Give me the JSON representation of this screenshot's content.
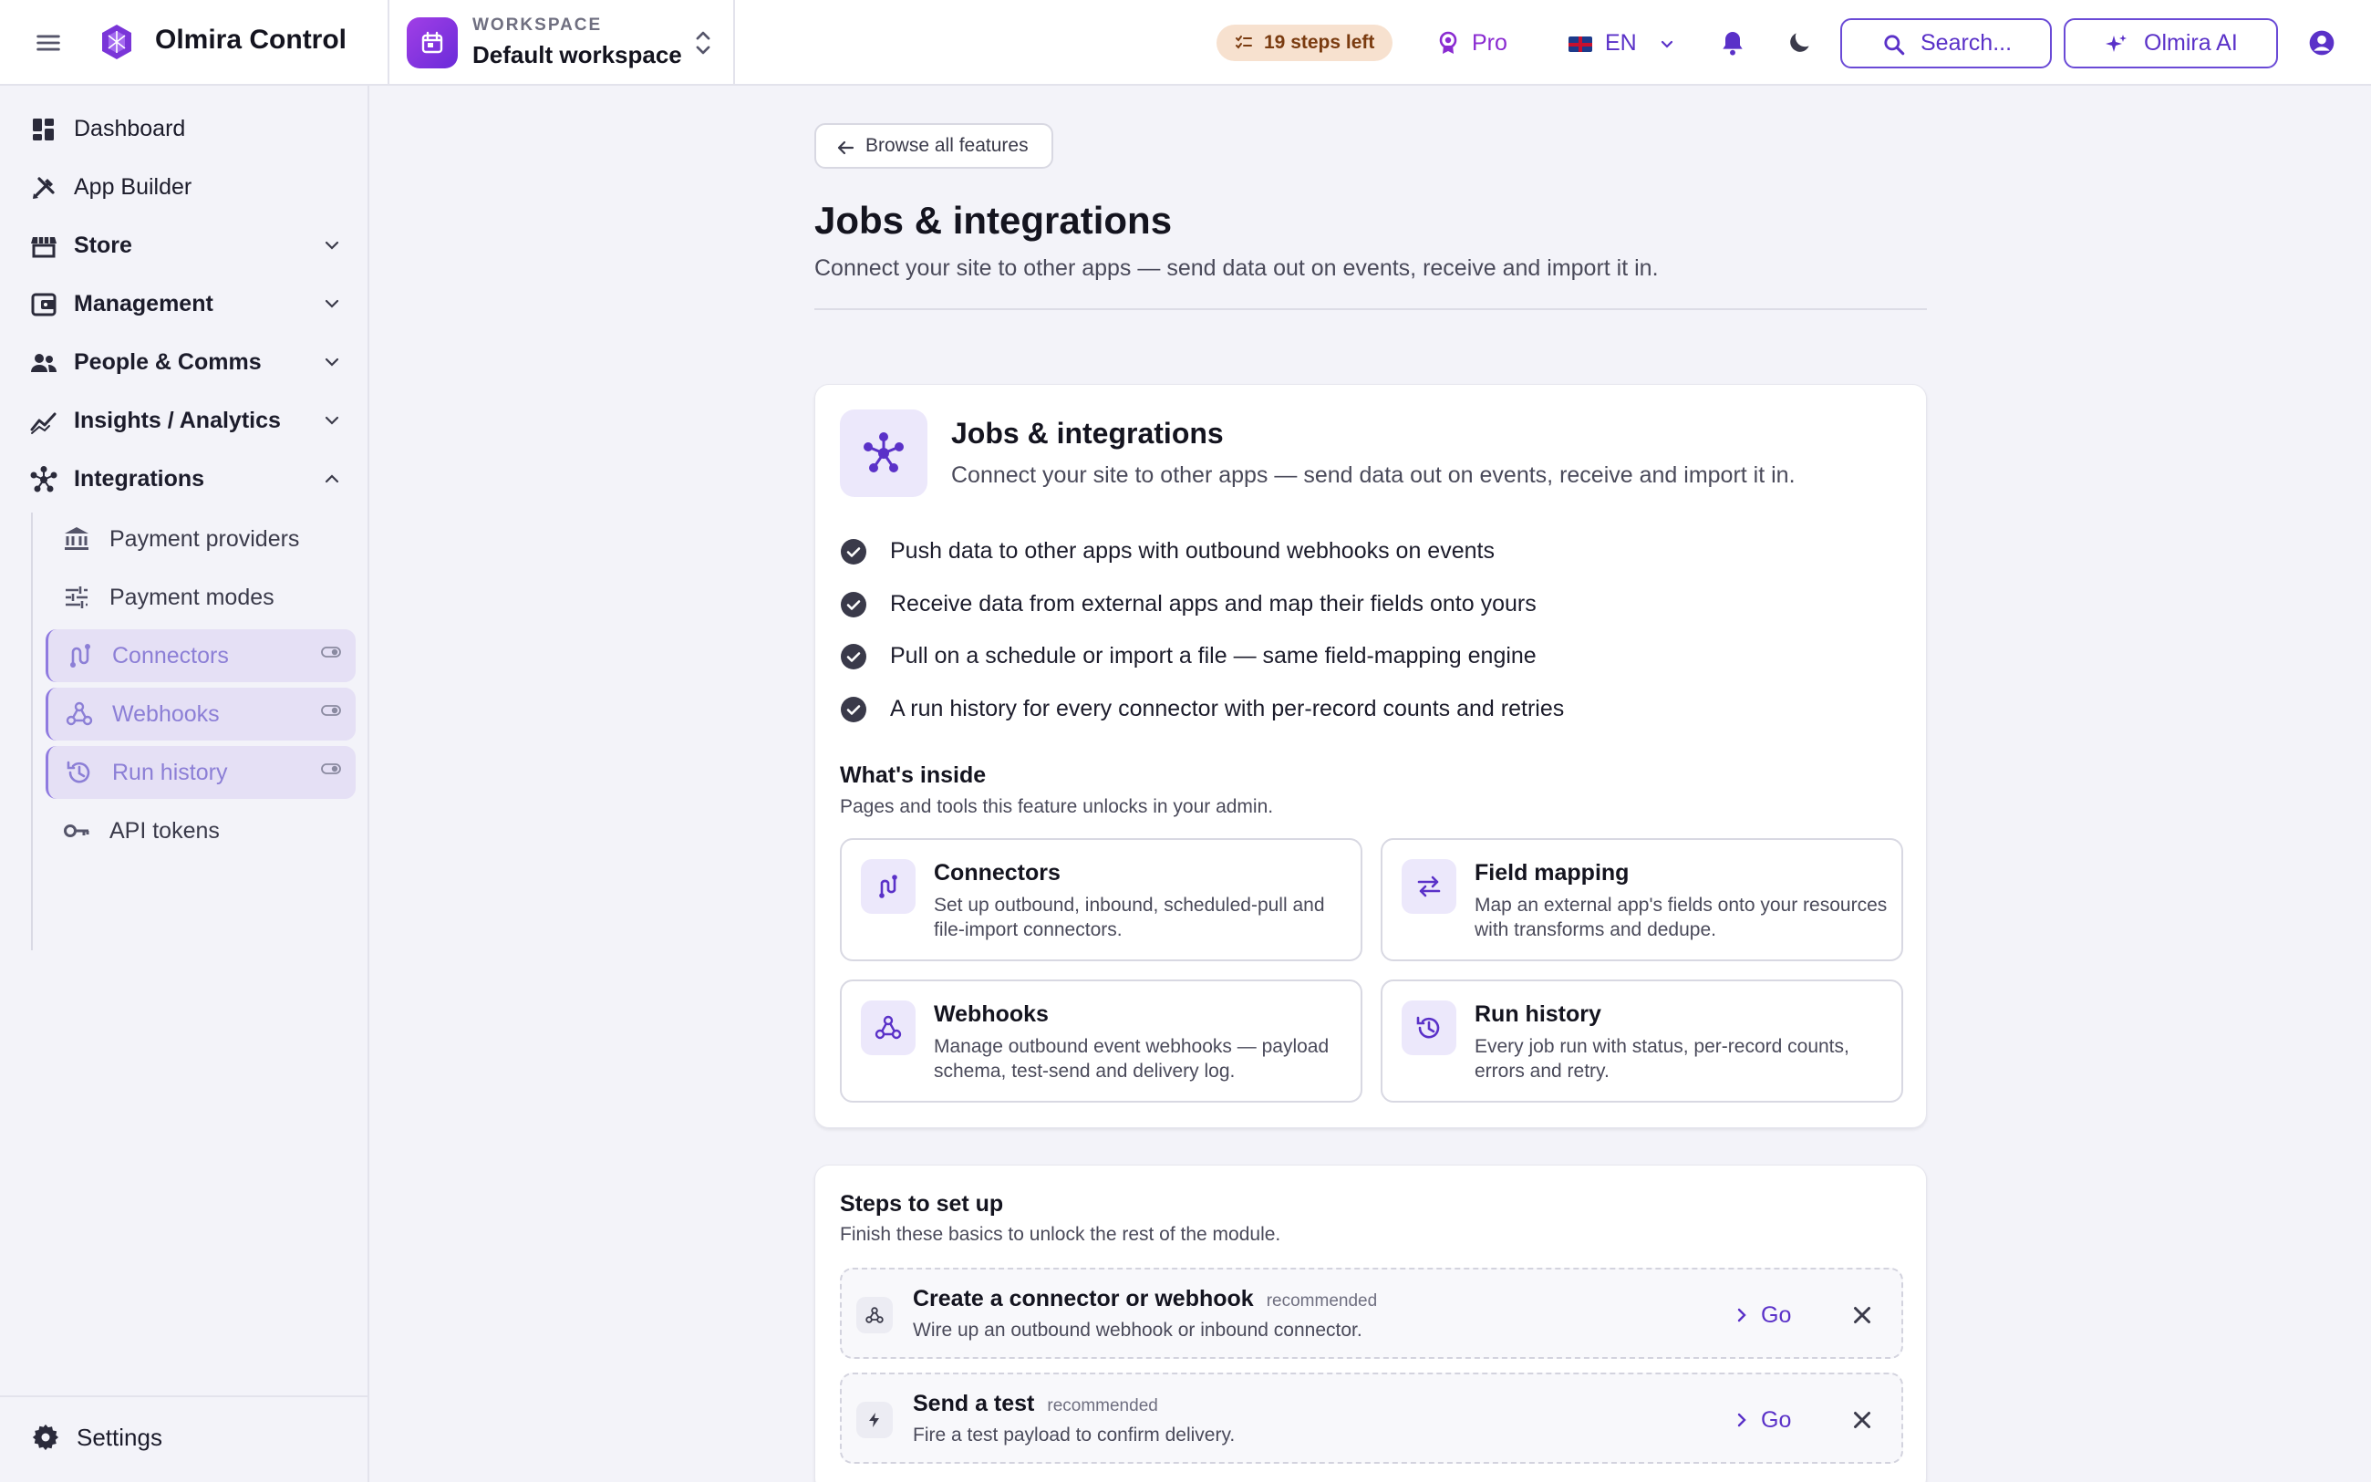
{
  "app": {
    "name": "Olmira Control"
  },
  "workspace": {
    "kicker": "WORKSPACE",
    "name": "Default workspace"
  },
  "topbar": {
    "steps_left": "19 steps left",
    "plan": "Pro",
    "language": "EN",
    "search_label": "Search...",
    "ai_label": "Olmira AI"
  },
  "sidebar": {
    "items": [
      {
        "label": "Dashboard",
        "icon": "dashboard-icon"
      },
      {
        "label": "App Builder",
        "icon": "design-tools-icon"
      },
      {
        "label": "Store",
        "icon": "store-icon"
      },
      {
        "label": "Management",
        "icon": "wallet-icon"
      },
      {
        "label": "People & Comms",
        "icon": "people-icon"
      },
      {
        "label": "Insights / Analytics",
        "icon": "analytics-icon"
      },
      {
        "label": "Integrations",
        "icon": "hub-icon"
      }
    ],
    "sub_items": [
      {
        "label": "Payment providers",
        "icon": "bank-icon",
        "locked": false
      },
      {
        "label": "Payment modes",
        "icon": "sliders-icon",
        "locked": false
      },
      {
        "label": "Connectors",
        "icon": "connector-icon",
        "locked": true
      },
      {
        "label": "Webhooks",
        "icon": "webhook-icon",
        "locked": true
      },
      {
        "label": "Run history",
        "icon": "history-icon",
        "locked": true
      },
      {
        "label": "API tokens",
        "icon": "key-icon",
        "locked": false
      }
    ],
    "settings_label": "Settings"
  },
  "page": {
    "back_label": "Browse all features",
    "title": "Jobs & integrations",
    "subtitle": "Connect your site to other apps — send data out on events, receive and import it in."
  },
  "feature": {
    "title": "Jobs & integrations",
    "subtitle": "Connect your site to other apps — send data out on events, receive and import it in.",
    "bullets": [
      "Push data to other apps with outbound webhooks on events",
      "Receive data from external apps and map their fields onto yours",
      "Pull on a schedule or import a file — same field-mapping engine",
      "A run history for every connector with per-record counts and retries"
    ],
    "inside_title": "What's inside",
    "inside_subtitle": "Pages and tools this feature unlocks in your admin.",
    "tiles": [
      {
        "title": "Connectors",
        "desc": "Set up outbound, inbound, scheduled-pull and file-import connectors.",
        "icon": "connector-icon"
      },
      {
        "title": "Field mapping",
        "desc": "Map an external app's fields onto your resources with transforms and dedupe.",
        "icon": "swap-arrows-icon"
      },
      {
        "title": "Webhooks",
        "desc": "Manage outbound event webhooks — payload schema, test-send and delivery log.",
        "icon": "webhook-icon"
      },
      {
        "title": "Run history",
        "desc": "Every job run with status, per-record counts, errors and retry.",
        "icon": "history-icon"
      }
    ]
  },
  "setup": {
    "title": "Steps to set up",
    "subtitle": "Finish these basics to unlock the rest of the module.",
    "steps": [
      {
        "title": "Create a connector or webhook",
        "badge": "recommended",
        "desc": "Wire up an outbound webhook or inbound connector.",
        "go": "Go",
        "icon": "webhook-icon"
      },
      {
        "title": "Send a test",
        "badge": "recommended",
        "desc": "Fire a test payload to confirm delivery.",
        "go": "Go",
        "icon": "bolt-icon"
      }
    ]
  },
  "colors": {
    "accent": "#5a31c8",
    "brand": "#7a35d8",
    "steps_pill": "#f7e1cf",
    "locked_bg": "#e5e0f5"
  }
}
